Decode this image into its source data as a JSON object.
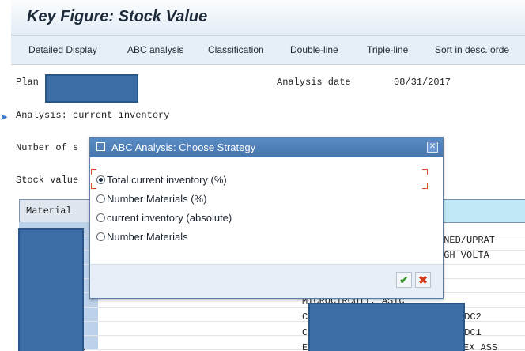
{
  "page_title": "Key Figure: Stock Value",
  "toolbar": {
    "buttons": [
      "Detailed Display",
      "ABC analysis",
      "Classification",
      "Double-line",
      "Triple-line",
      "Sort in desc. orde"
    ]
  },
  "report": {
    "plant_label": "Plan",
    "analysis_date_label": "Analysis date",
    "analysis_date": "08/31/2017",
    "analysis_line": "Analysis: current inventory",
    "number_label": "Number of s",
    "stock_value_label": "Stock value",
    "column_header": "Material",
    "row_texts": [
      "RNED/UPRAT",
      "IGH VOLTA",
      "MICROCIRCUIT, ASIC",
      "C",
      "PDC2",
      "C",
      "PDC1",
      "A",
      "E",
      "EX ASS"
    ]
  },
  "dialog": {
    "title": "ABC Analysis: Choose Strategy",
    "options": [
      {
        "label": "Total current inventory (%)",
        "selected": true
      },
      {
        "label": "Number Materials (%)",
        "selected": false
      },
      {
        "label": "current inventory (absolute)",
        "selected": false
      },
      {
        "label": "Number Materials",
        "selected": false
      }
    ],
    "confirm_icon": "checkmark-icon",
    "cancel_icon": "cancel-x-icon"
  },
  "colors": {
    "dialog_title_bg": "#4a7cb5",
    "redaction": "#3d6ea6",
    "confirm": "#3a9a2e",
    "cancel": "#d63a1a"
  }
}
